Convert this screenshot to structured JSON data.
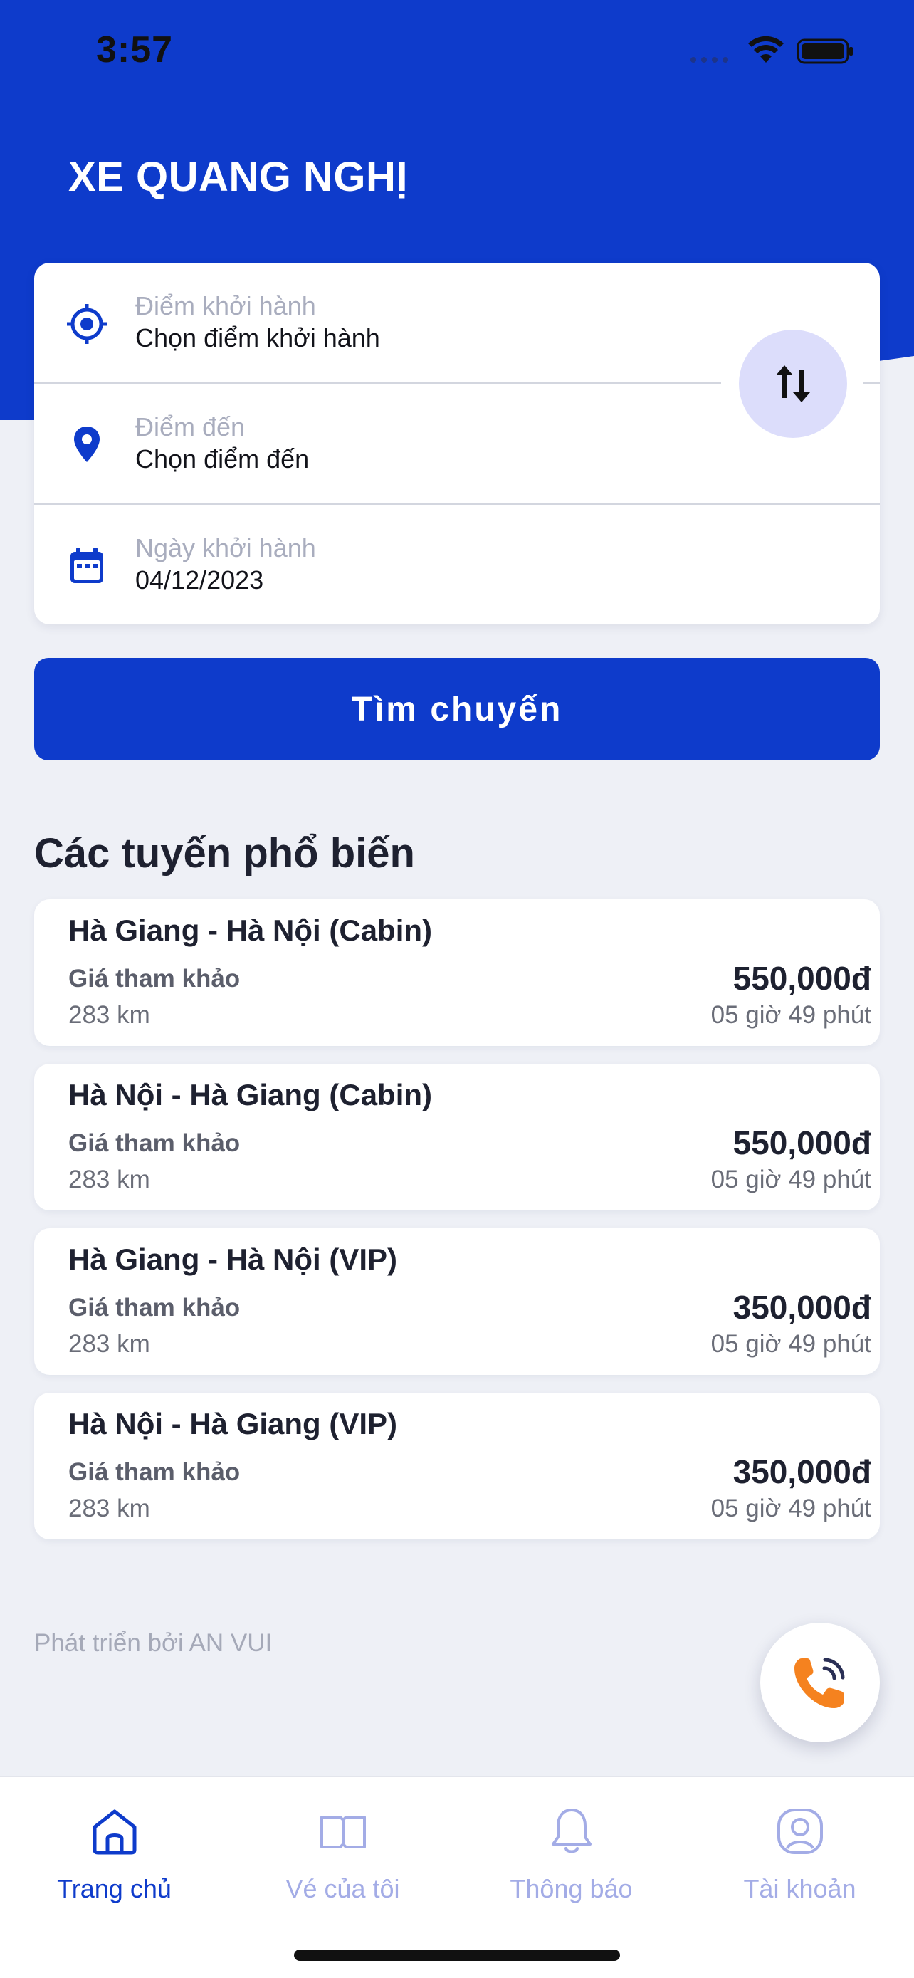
{
  "status_bar": {
    "time": "3:57"
  },
  "app": {
    "title": "XE QUANG NGHỊ"
  },
  "search": {
    "origin": {
      "label": "Điểm khởi hành",
      "value": "Chọn điểm khởi hành",
      "icon": "target-icon"
    },
    "destination": {
      "label": "Điểm đến",
      "value": "Chọn điểm đến",
      "icon": "location-pin-icon"
    },
    "date": {
      "label": "Ngày khởi hành",
      "value": "04/12/2023",
      "icon": "calendar-icon"
    },
    "swap_icon": "swap-vertical-icon",
    "button_label": "Tìm chuyến"
  },
  "popular": {
    "title": "Các tuyến phổ biến",
    "routes": [
      {
        "name": "Hà Giang - Hà Nội (Cabin)",
        "hint": "Giá tham khảo",
        "distance": "283 km",
        "price": "550,000đ",
        "duration": "05 giờ 49 phút"
      },
      {
        "name": "Hà Nội - Hà Giang (Cabin)",
        "hint": "Giá tham khảo",
        "distance": "283 km",
        "price": "550,000đ",
        "duration": "05 giờ 49 phút"
      },
      {
        "name": "Hà Giang - Hà Nội (VIP)",
        "hint": "Giá tham khảo",
        "distance": "283 km",
        "price": "350,000đ",
        "duration": "05 giờ 49 phút"
      },
      {
        "name": "Hà Nội - Hà Giang (VIP)",
        "hint": "Giá tham khảo",
        "distance": "283 km",
        "price": "350,000đ",
        "duration": "05 giờ 49 phút"
      }
    ]
  },
  "footer": {
    "credit": "Phát triển bởi AN VUI"
  },
  "tabs": [
    {
      "label": "Trang chủ",
      "icon": "home-icon",
      "active": true
    },
    {
      "label": "Vé của tôi",
      "icon": "ticket-book-icon",
      "active": false
    },
    {
      "label": "Thông báo",
      "icon": "bell-icon",
      "active": false
    },
    {
      "label": "Tài khoản",
      "icon": "account-icon",
      "active": false
    }
  ],
  "colors": {
    "primary": "#0E3BCB",
    "background": "#EEF0F6",
    "accent_call": "#F5821F",
    "inactive_tab": "#A3ACE6"
  }
}
